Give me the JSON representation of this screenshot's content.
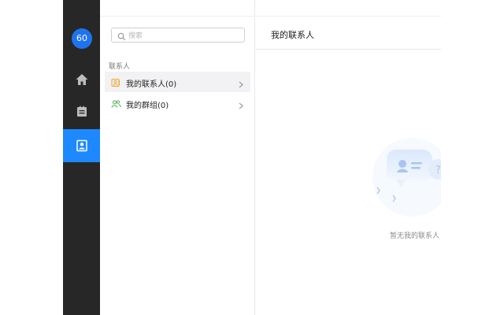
{
  "rail": {
    "avatar_text": "60",
    "items": [
      {
        "name": "home-icon"
      },
      {
        "name": "notebook-icon"
      },
      {
        "name": "contacts-icon",
        "active": true
      }
    ]
  },
  "panel": {
    "search_placeholder": "搜索",
    "section_label": "联系人",
    "rows": [
      {
        "label": "我的联系人(0)",
        "selected": true
      },
      {
        "label": "我的群组(0)",
        "selected": false
      }
    ]
  },
  "main": {
    "title": "我的联系人",
    "empty_text": "暂无我的联系人"
  },
  "colors": {
    "rail_bg": "#272727",
    "accent": "#1e88ff",
    "avatar": "#1e74f0",
    "contact_icon": "#f0a830",
    "group_icon": "#4caf50"
  }
}
